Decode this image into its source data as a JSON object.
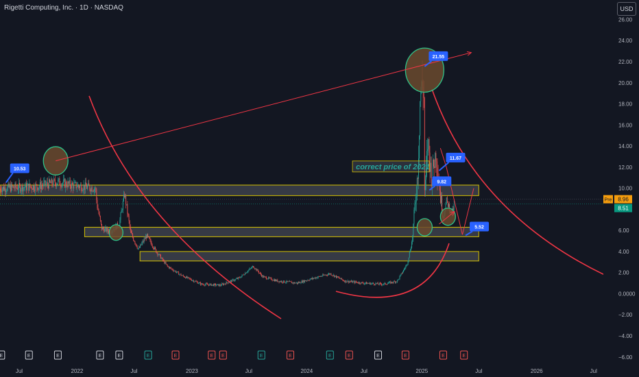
{
  "header": {
    "title": "Rigetti Computing, Inc. · 1D · NASDAQ",
    "currency": "USD"
  },
  "colors": {
    "background": "#131722",
    "grid": "#1e222d",
    "up": "#26a69a",
    "down": "#ef5350",
    "trend": "#f23645",
    "zone_border": "#d4c000",
    "callout": "#2962ff",
    "circle_fill": "#6b4a2e",
    "circle_stroke": "#2ec48a",
    "text_label": "#26a69a",
    "pre_label": "#f59d0e",
    "last_label": "#089981"
  },
  "chart_data": {
    "type": "candlestick",
    "y_axis": {
      "ticks": [
        "26.00",
        "24.00",
        "22.00",
        "20.00",
        "18.00",
        "16.00",
        "14.00",
        "12.00",
        "10.00",
        "8.00",
        "6.00",
        "4.00",
        "2.00",
        "0.0000",
        "−2.00",
        "−4.00",
        "−6.00"
      ],
      "range": [
        -6,
        26
      ]
    },
    "x_axis": {
      "ticks": [
        "Jul",
        "2022",
        "Jul",
        "2023",
        "Jul",
        "2024",
        "Jul",
        "2025",
        "Jul",
        "2026",
        "Jul"
      ],
      "range": [
        "2021-05",
        "2026-08"
      ]
    },
    "grid": false,
    "price_path": [
      [
        "2021-05-01",
        10.0
      ],
      [
        "2021-07-01",
        10.1
      ],
      [
        "2021-09-01",
        10.2
      ],
      [
        "2021-11-01",
        10.6
      ],
      [
        "2021-12-15",
        10.3
      ],
      [
        "2022-03-01",
        10.0
      ],
      [
        "2022-03-05",
        8.5
      ],
      [
        "2022-03-20",
        6.2
      ],
      [
        "2022-04-15",
        5.9
      ],
      [
        "2022-05-15",
        6.6
      ],
      [
        "2022-06-01",
        9.5
      ],
      [
        "2022-06-20",
        5.8
      ],
      [
        "2022-07-15",
        4.2
      ],
      [
        "2022-08-10",
        5.5
      ],
      [
        "2022-09-10",
        4.0
      ],
      [
        "2022-10-15",
        2.6
      ],
      [
        "2022-12-01",
        1.7
      ],
      [
        "2023-02-01",
        0.9
      ],
      [
        "2023-04-01",
        0.8
      ],
      [
        "2023-06-01",
        1.5
      ],
      [
        "2023-07-15",
        2.6
      ],
      [
        "2023-08-15",
        1.6
      ],
      [
        "2023-10-01",
        1.2
      ],
      [
        "2023-12-01",
        1.0
      ],
      [
        "2024-01-15",
        1.4
      ],
      [
        "2024-03-15",
        1.9
      ],
      [
        "2024-05-01",
        1.2
      ],
      [
        "2024-07-01",
        1.0
      ],
      [
        "2024-09-01",
        0.9
      ],
      [
        "2024-10-15",
        1.2
      ],
      [
        "2024-11-15",
        2.8
      ],
      [
        "2024-12-01",
        5.0
      ],
      [
        "2024-12-20",
        12.0
      ],
      [
        "2024-12-27",
        19.0
      ],
      [
        "2025-01-07",
        20.0
      ],
      [
        "2025-01-10",
        9.0
      ],
      [
        "2025-01-20",
        14.5
      ],
      [
        "2025-02-01",
        11.0
      ],
      [
        "2025-02-15",
        13.5
      ],
      [
        "2025-03-01",
        9.2
      ],
      [
        "2025-03-10",
        7.2
      ],
      [
        "2025-03-20",
        8.8
      ],
      [
        "2025-04-07",
        7.6
      ],
      [
        "2025-04-15",
        8.5
      ]
    ],
    "annotations": {
      "callouts": [
        {
          "date": "2021-05-20",
          "value": "10.53"
        },
        {
          "date": "2025-01-10",
          "value": "21.55"
        },
        {
          "date": "2025-02-25",
          "value": "11.67"
        },
        {
          "date": "2025-01-25",
          "value": "9.82"
        },
        {
          "date": "2025-05-20",
          "value": "5.52"
        }
      ],
      "text_note": "correct price of 2021",
      "zones": [
        {
          "from": "2021-05-01",
          "to": "2025-07-01",
          "low": 9.3,
          "high": 10.3
        },
        {
          "from": "2022-01-25",
          "to": "2025-07-01",
          "low": 5.4,
          "high": 6.3
        },
        {
          "from": "2022-07-20",
          "to": "2025-07-01",
          "low": 3.1,
          "high": 4.0
        }
      ],
      "circles": [
        {
          "date": "2021-10-25",
          "value": 12.6
        },
        {
          "date": "2022-05-05",
          "value": 5.8
        },
        {
          "date": "2025-01-10",
          "value": 21.2
        },
        {
          "date": "2025-01-10",
          "value": 6.3
        },
        {
          "date": "2025-03-25",
          "value": 7.3
        }
      ],
      "trend_line": {
        "from": [
          "2021-10-25",
          12.6
        ],
        "to": [
          "2025-03-01",
          22.8
        ]
      },
      "projection": [
        [
          "2025-03-01",
          13.8
        ],
        [
          "2025-03-20",
          12.0
        ],
        [
          "2025-05-10",
          5.6
        ],
        [
          "2025-06-15",
          10.0
        ]
      ],
      "small_arrow": [
        [
          "2025-02-25",
          6.6
        ],
        [
          "2025-04-15",
          7.8
        ]
      ]
    },
    "events": [
      {
        "date": "2021-05-05",
        "type": "E",
        "kind": "neutral"
      },
      {
        "date": "2021-08-01",
        "type": "E",
        "kind": "neutral"
      },
      {
        "date": "2021-11-01",
        "type": "E",
        "kind": "neutral"
      },
      {
        "date": "2022-03-15",
        "type": "E",
        "kind": "neutral"
      },
      {
        "date": "2022-05-15",
        "type": "E",
        "kind": "neutral"
      },
      {
        "date": "2022-08-15",
        "type": "E",
        "kind": "up"
      },
      {
        "date": "2022-11-10",
        "type": "E",
        "kind": "down"
      },
      {
        "date": "2023-03-05",
        "type": "E",
        "kind": "down"
      },
      {
        "date": "2023-04-10",
        "type": "E",
        "kind": "down"
      },
      {
        "date": "2023-08-10",
        "type": "E",
        "kind": "up"
      },
      {
        "date": "2023-11-10",
        "type": "E",
        "kind": "down"
      },
      {
        "date": "2024-03-15",
        "type": "E",
        "kind": "up"
      },
      {
        "date": "2024-05-15",
        "type": "E",
        "kind": "down"
      },
      {
        "date": "2024-08-15",
        "type": "E",
        "kind": "neutral"
      },
      {
        "date": "2024-11-10",
        "type": "E",
        "kind": "down"
      },
      {
        "date": "2025-03-10",
        "type": "E",
        "kind": "down"
      },
      {
        "date": "2025-05-15",
        "type": "E",
        "kind": "down"
      }
    ],
    "price_labels": {
      "pre": {
        "label": "Pre",
        "value": "8.96",
        "numeric": 8.96
      },
      "last": {
        "value": "8.51",
        "numeric": 8.51
      }
    }
  }
}
